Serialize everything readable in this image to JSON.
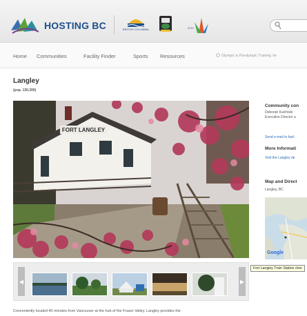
{
  "header": {
    "logo_text": "HOSTING BC",
    "partner_bc_caption": "BRITISH COLUMBIA",
    "search_placeholder": ""
  },
  "nav": {
    "items": [
      "Home",
      "Communities",
      "Facility Finder",
      "Sports",
      "Resources"
    ],
    "right_link": "Olympic & Paralympic Training Ve"
  },
  "page": {
    "title": "Langley",
    "population": "(pop. 130,300)",
    "photo_sign": "FORT LANGLEY"
  },
  "sidebar": {
    "contact_heading": "Community con",
    "contact_name": "Deborah Kulchiski",
    "contact_role": "Executive Director a",
    "email_link": "Send e-mail to facil",
    "info_heading": "More Informati",
    "info_link": "Visit the Langley de",
    "map_heading": "Map and Direct",
    "map_location": "Langley, BC",
    "map_google": "Google"
  },
  "tooltip": "Fort Langley Train Station cher",
  "intro_text": "Conveniently located 40 minutes from Vancouver at the hub of the Fraser Valley, Langley provides the",
  "colors": {
    "brand_blue": "#1d4f8c",
    "link_blue": "#2a6db5",
    "blossom_pink": "#b33a5a"
  }
}
